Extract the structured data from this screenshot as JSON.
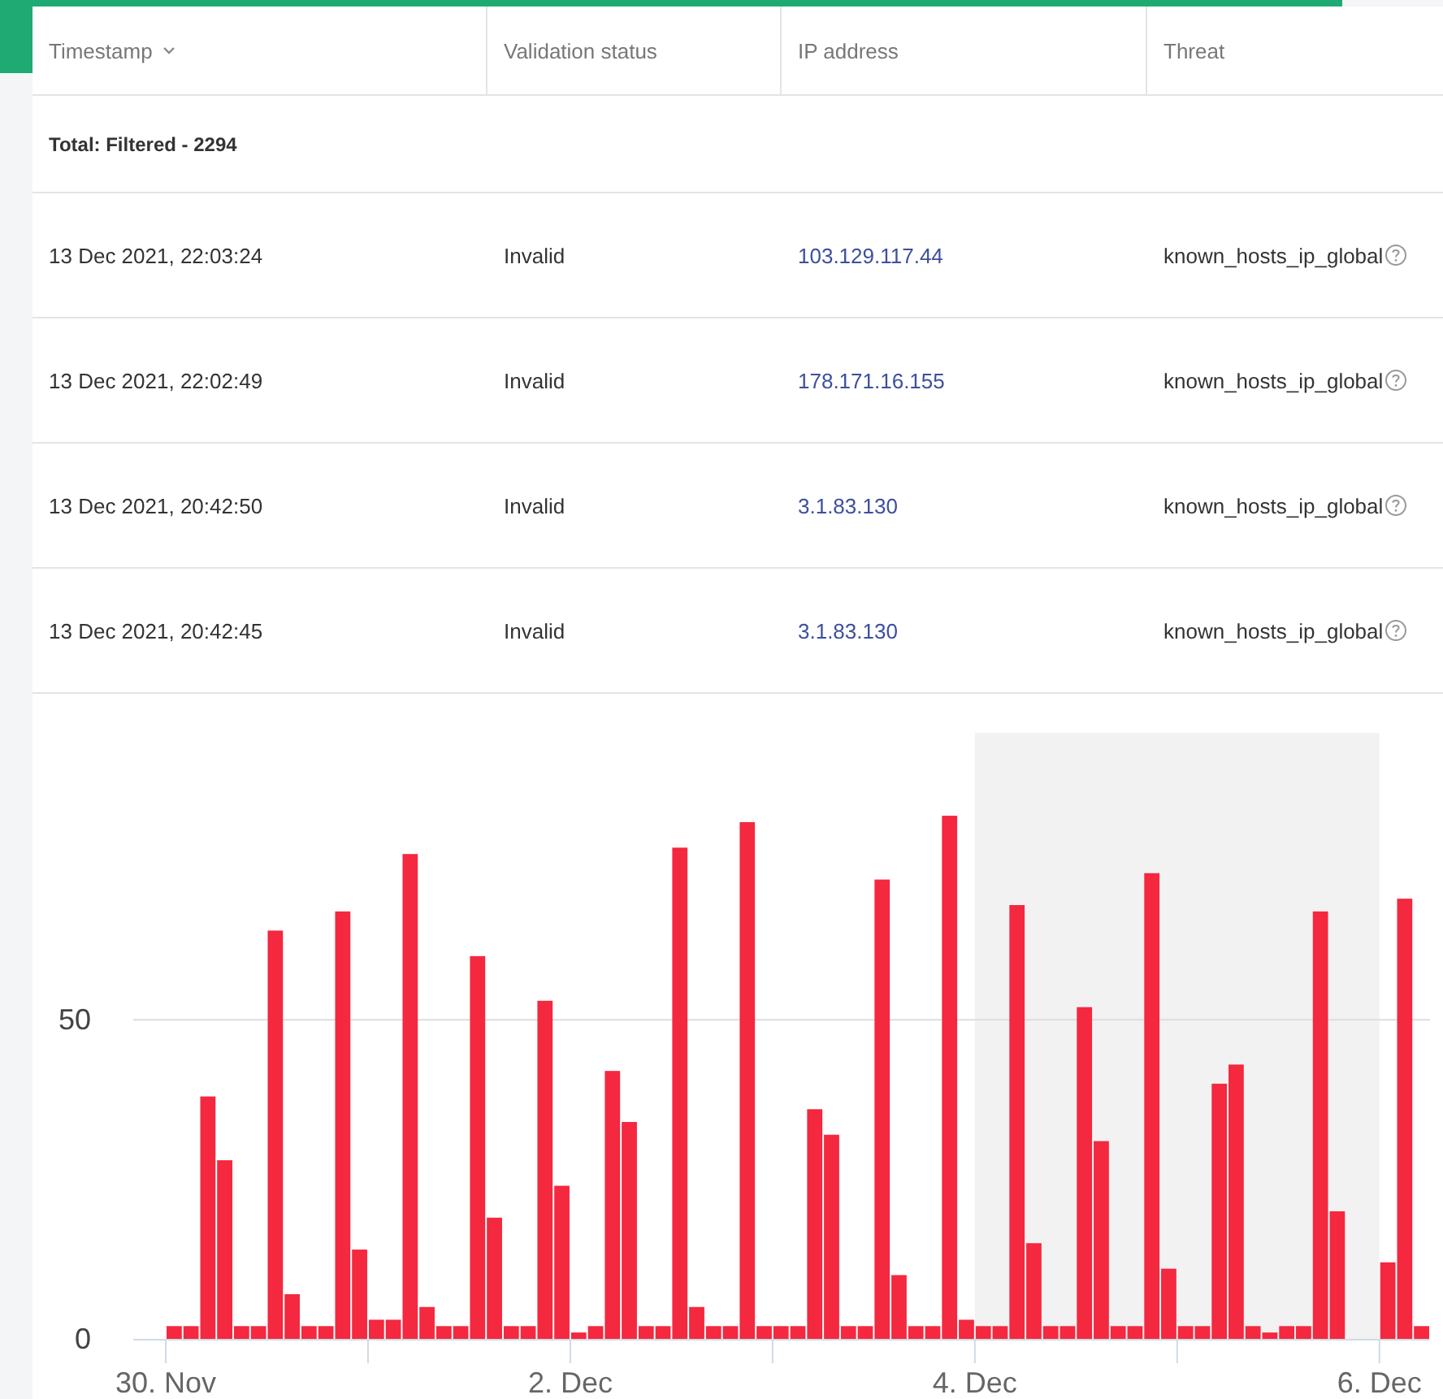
{
  "table": {
    "columns": [
      {
        "label": "Timestamp",
        "sorted": true
      },
      {
        "label": "Validation status",
        "sorted": false
      },
      {
        "label": "IP address",
        "sorted": false
      },
      {
        "label": "Threat",
        "sorted": false
      }
    ],
    "total": "Total: Filtered - 2294",
    "rows": [
      {
        "timestamp": "13 Dec 2021, 22:03:24",
        "validation_status": "Invalid",
        "ip_address": "103.129.117.44",
        "threat": "known_hosts_ip_global"
      },
      {
        "timestamp": "13 Dec 2021, 22:02:49",
        "validation_status": "Invalid",
        "ip_address": "178.171.16.155",
        "threat": "known_hosts_ip_global"
      },
      {
        "timestamp": "13 Dec 2021, 20:42:50",
        "validation_status": "Invalid",
        "ip_address": "3.1.83.130",
        "threat": "known_hosts_ip_global"
      },
      {
        "timestamp": "13 Dec 2021, 20:42:45",
        "validation_status": "Invalid",
        "ip_address": "3.1.83.130",
        "threat": "known_hosts_ip_global"
      }
    ]
  },
  "chart": {
    "chart_data": {
      "type": "bar",
      "categories": [
        "30. Nov",
        null,
        null,
        null,
        null,
        null,
        null,
        null,
        null,
        null,
        null,
        null,
        null,
        null,
        null,
        null,
        null,
        null,
        null,
        null,
        null,
        null,
        null,
        null,
        "2. Dec",
        null,
        null,
        null,
        null,
        null,
        null,
        null,
        null,
        null,
        null,
        null,
        null,
        null,
        null,
        null,
        null,
        null,
        null,
        null,
        null,
        null,
        null,
        null,
        "4. Dec",
        null,
        null,
        null,
        null,
        null,
        null,
        null,
        null,
        null,
        null,
        null,
        null,
        null,
        null,
        null,
        null,
        null,
        null,
        null,
        null,
        null,
        null,
        null,
        "6. Dec",
        null,
        null
      ],
      "series": [
        {
          "color": "#f4283e",
          "values": [
            2,
            2,
            38,
            28,
            2,
            2,
            64,
            7,
            2,
            2,
            67,
            14,
            3,
            3,
            76,
            5,
            2,
            2,
            60,
            19,
            2,
            2,
            53,
            24,
            1,
            2,
            42,
            34,
            2,
            2,
            77,
            5,
            2,
            2,
            81,
            2,
            2,
            2,
            36,
            32,
            2,
            2,
            72,
            10,
            2,
            2,
            82,
            3,
            2,
            2,
            68,
            15,
            2,
            2,
            52,
            31,
            2,
            2,
            73,
            11,
            2,
            2,
            40,
            43,
            2,
            1,
            2,
            2,
            67,
            20,
            0,
            0,
            12,
            69,
            2
          ]
        }
      ],
      "ylim": [
        0,
        95
      ],
      "yticks": [
        0,
        50
      ]
    },
    "range_highlighted": true
  }
}
